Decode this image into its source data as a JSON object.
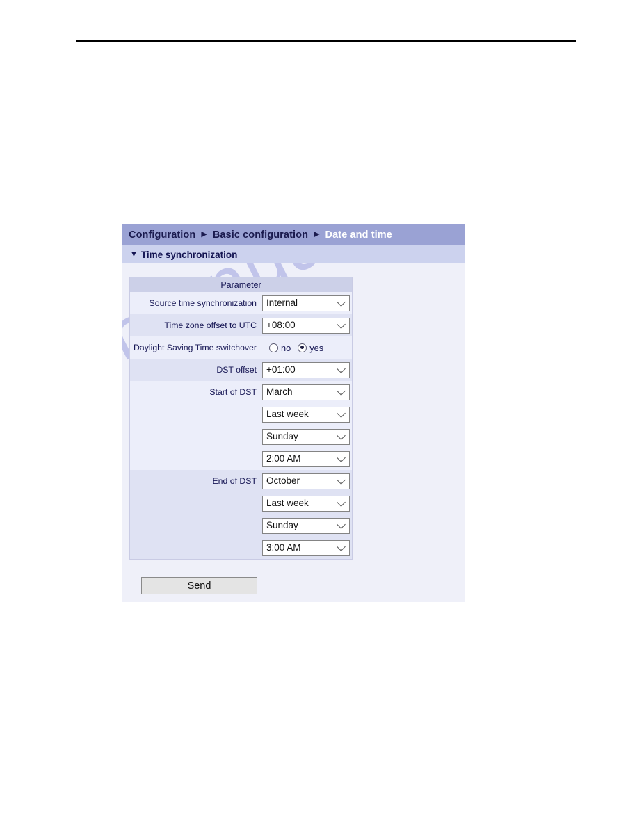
{
  "page": {
    "rule_visible": true
  },
  "watermark": {
    "text": "manualshive.com"
  },
  "breadcrumb": {
    "separator": "▶",
    "items": [
      {
        "label": "Configuration",
        "active": false
      },
      {
        "label": "Basic configuration",
        "active": false
      },
      {
        "label": "Date and time",
        "active": true
      }
    ]
  },
  "section": {
    "toggle_icon": "▼",
    "title": "Time synchronization"
  },
  "table": {
    "header": "Parameter",
    "rows": [
      {
        "label": "Source time synchronization",
        "type": "select",
        "value": "Internal",
        "name": "source-time-synchronization",
        "stripe": "lite"
      },
      {
        "label": "Time zone offset to UTC",
        "type": "select",
        "value": "+08:00",
        "name": "time-zone-offset-to-utc",
        "stripe": "alt"
      },
      {
        "label": "Daylight Saving Time switchover",
        "type": "radio",
        "name": "daylight-saving-time-switchover",
        "stripe": "lite",
        "options": [
          {
            "label": "no",
            "selected": false
          },
          {
            "label": "yes",
            "selected": true
          }
        ]
      },
      {
        "label": "DST offset",
        "type": "select",
        "value": "+01:00",
        "name": "dst-offset",
        "stripe": "alt"
      },
      {
        "label": "Start of DST",
        "type": "select",
        "value": "March",
        "name": "start-of-dst-month",
        "stripe": "lite"
      },
      {
        "label": "",
        "type": "select",
        "value": "Last week",
        "name": "start-of-dst-week",
        "stripe": "lite"
      },
      {
        "label": "",
        "type": "select",
        "value": "Sunday",
        "name": "start-of-dst-day",
        "stripe": "lite"
      },
      {
        "label": "",
        "type": "select",
        "value": "2:00 AM",
        "name": "start-of-dst-time",
        "stripe": "lite"
      },
      {
        "label": "End of DST",
        "type": "select",
        "value": "October",
        "name": "end-of-dst-month",
        "stripe": "alt"
      },
      {
        "label": "",
        "type": "select",
        "value": "Last week",
        "name": "end-of-dst-week",
        "stripe": "alt"
      },
      {
        "label": "",
        "type": "select",
        "value": "Sunday",
        "name": "end-of-dst-day",
        "stripe": "alt"
      },
      {
        "label": "",
        "type": "select",
        "value": "3:00 AM",
        "name": "end-of-dst-time",
        "stripe": "alt"
      }
    ]
  },
  "actions": {
    "send_label": "Send"
  },
  "colors": {
    "crumb_bar": "#9aa2d4",
    "section_bar": "#ccd2ee",
    "panel_bg": "#eff0f9",
    "row_light": "#eceefa",
    "row_alt": "#dfe2f3",
    "table_head": "#ccd0e8",
    "text_navy": "#161654",
    "watermark": "#b9bde8"
  }
}
